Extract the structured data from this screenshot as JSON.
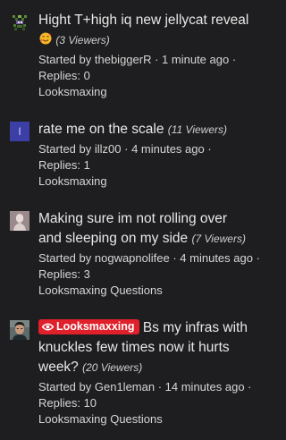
{
  "threads": [
    {
      "title": "Hight T+high iq new jellycat reveal",
      "viewers": "(3 Viewers)",
      "started_by_prefix": "Started by ",
      "author": "thebiggerR",
      "time": "1 minute ago",
      "replies": "Replies: 0",
      "forum": "Looksmaxing",
      "avatar_icon": "pixel-creature-avatar",
      "emoji_icon": "smiling-face-with-hearts-emoji"
    },
    {
      "title": "rate me on the scale",
      "viewers": "(11 Viewers)",
      "started_by_prefix": "Started by ",
      "author": "illz00",
      "time": "4 minutes ago",
      "replies": "Replies: 1",
      "forum": "Looksmaxing",
      "avatar_letter": "I",
      "avatar_color": "#3b3fa6"
    },
    {
      "title": "Making sure im not rolling over and sleeping on my side",
      "viewers": "(7 Viewers)",
      "started_by_prefix": "Started by ",
      "author": "nogwapnolifee",
      "time": "4 minutes ago",
      "replies": "Replies: 3",
      "forum": "Looksmaxing Questions",
      "avatar_icon": "statue-avatar"
    },
    {
      "prefix": "Looksmaxxing",
      "prefix_color": "#e0202b",
      "title": "Bs my infras with knuckles few times now it hurts week?",
      "viewers": "(20 Viewers)",
      "started_by_prefix": "Started by ",
      "author": "Gen1leman",
      "time": "14 minutes ago",
      "replies": "Replies: 10",
      "forum": "Looksmaxing Questions",
      "avatar_icon": "man-portrait-avatar"
    }
  ]
}
